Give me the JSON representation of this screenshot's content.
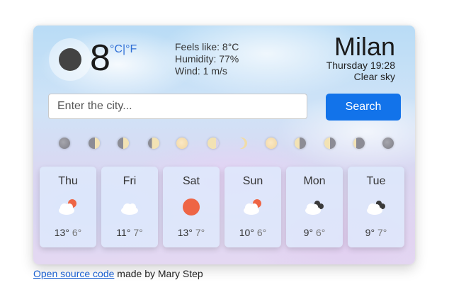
{
  "current": {
    "icon": "moon-icon",
    "temperature": "8",
    "units": "°C|°F",
    "feels_like": "Feels like: 8°C",
    "humidity": "Humidity: 77%",
    "wind": "Wind: 1 m/s",
    "city": "Milan",
    "datetime": "Thursday 19:28",
    "condition": "Clear sky"
  },
  "search": {
    "placeholder": "Enter the city...",
    "value": "",
    "button_label": "Search"
  },
  "moon_phases": [
    "new-moon",
    "waxing-crescent",
    "first-quarter",
    "waxing-gibbous",
    "full-moon",
    "waning-gibbous",
    "crescent",
    "full-moon",
    "last-quarter",
    "waning-gibbous",
    "waning-crescent",
    "new-moon"
  ],
  "forecast": [
    {
      "day": "Thu",
      "icon": "cloud-sun-icon",
      "high": "13°",
      "low": "6°"
    },
    {
      "day": "Fri",
      "icon": "cloud-icon",
      "high": "11°",
      "low": "7°"
    },
    {
      "day": "Sat",
      "icon": "sun-icon",
      "high": "13°",
      "low": "7°"
    },
    {
      "day": "Sun",
      "icon": "cloud-sun-icon",
      "high": "10°",
      "low": "6°"
    },
    {
      "day": "Mon",
      "icon": "cloud-dark-icon",
      "high": "9°",
      "low": "6°"
    },
    {
      "day": "Tue",
      "icon": "cloud-dark-icon",
      "high": "9°",
      "low": "7°"
    }
  ],
  "footer": {
    "link_text": "Open source code",
    "text": " made by Mary Step"
  },
  "colors": {
    "accent": "#1273ea",
    "sun": "#ee6545",
    "moon_dark": "#434343"
  }
}
